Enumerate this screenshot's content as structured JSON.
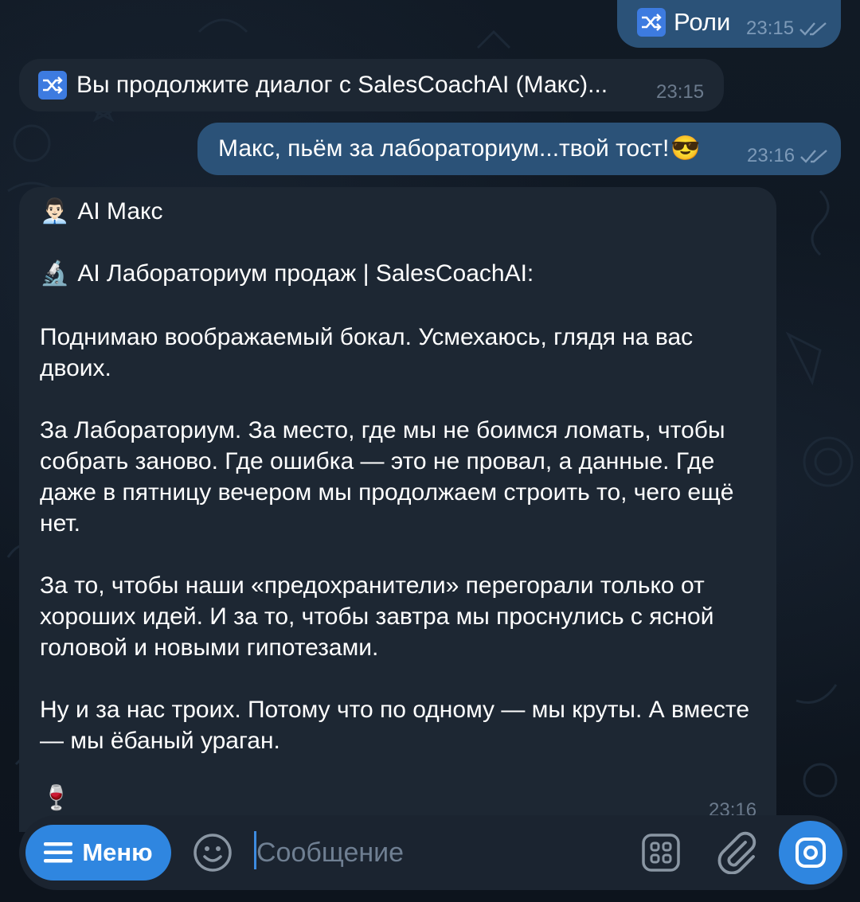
{
  "messages": {
    "m1": {
      "text": "Роли",
      "time": "23:15",
      "icon": "shuffle-icon"
    },
    "m2": {
      "text": "Вы продолжите диалог с SalesCoachAI (Макс)...",
      "time": "23:15",
      "icon": "shuffle-icon"
    },
    "m3": {
      "text": "Макс, пьём за лабораториум...твой тост!",
      "emoji": "😎",
      "time": "23:16"
    },
    "m4": {
      "author_emoji": "👨🏻‍💼",
      "author": "AI Макс",
      "header_emoji": "🔬",
      "header": "AI Лабораториум продаж | SalesCoachAI:",
      "p1": "Поднимаю воображаемый бокал. Усмехаюсь, глядя на вас двоих.",
      "p2": "За Лабораториум. За место, где мы не боимся ломать, чтобы собрать заново. Где ошибка — это не провал, а данные. Где даже в пятницу вечером мы продолжаем строить то, чего ещё нет.",
      "p3": "За то, чтобы наши «предохранители» перегорали только от хороших идей. И за то, чтобы завтра мы проснулись с ясной головой и новыми гипотезами.",
      "p4": "Ну и за нас троих. Потому что по одному — мы круты. А вместе — мы ёбаный ураган.",
      "footer_emoji": "🍷",
      "time": "23:16"
    }
  },
  "composer": {
    "menu_label": "Меню",
    "placeholder": "Сообщение"
  },
  "colors": {
    "outgoing_bubble": "#2b5278",
    "incoming_bubble": "#1d2733",
    "accent": "#2f86e0",
    "background": "#0f1620"
  }
}
